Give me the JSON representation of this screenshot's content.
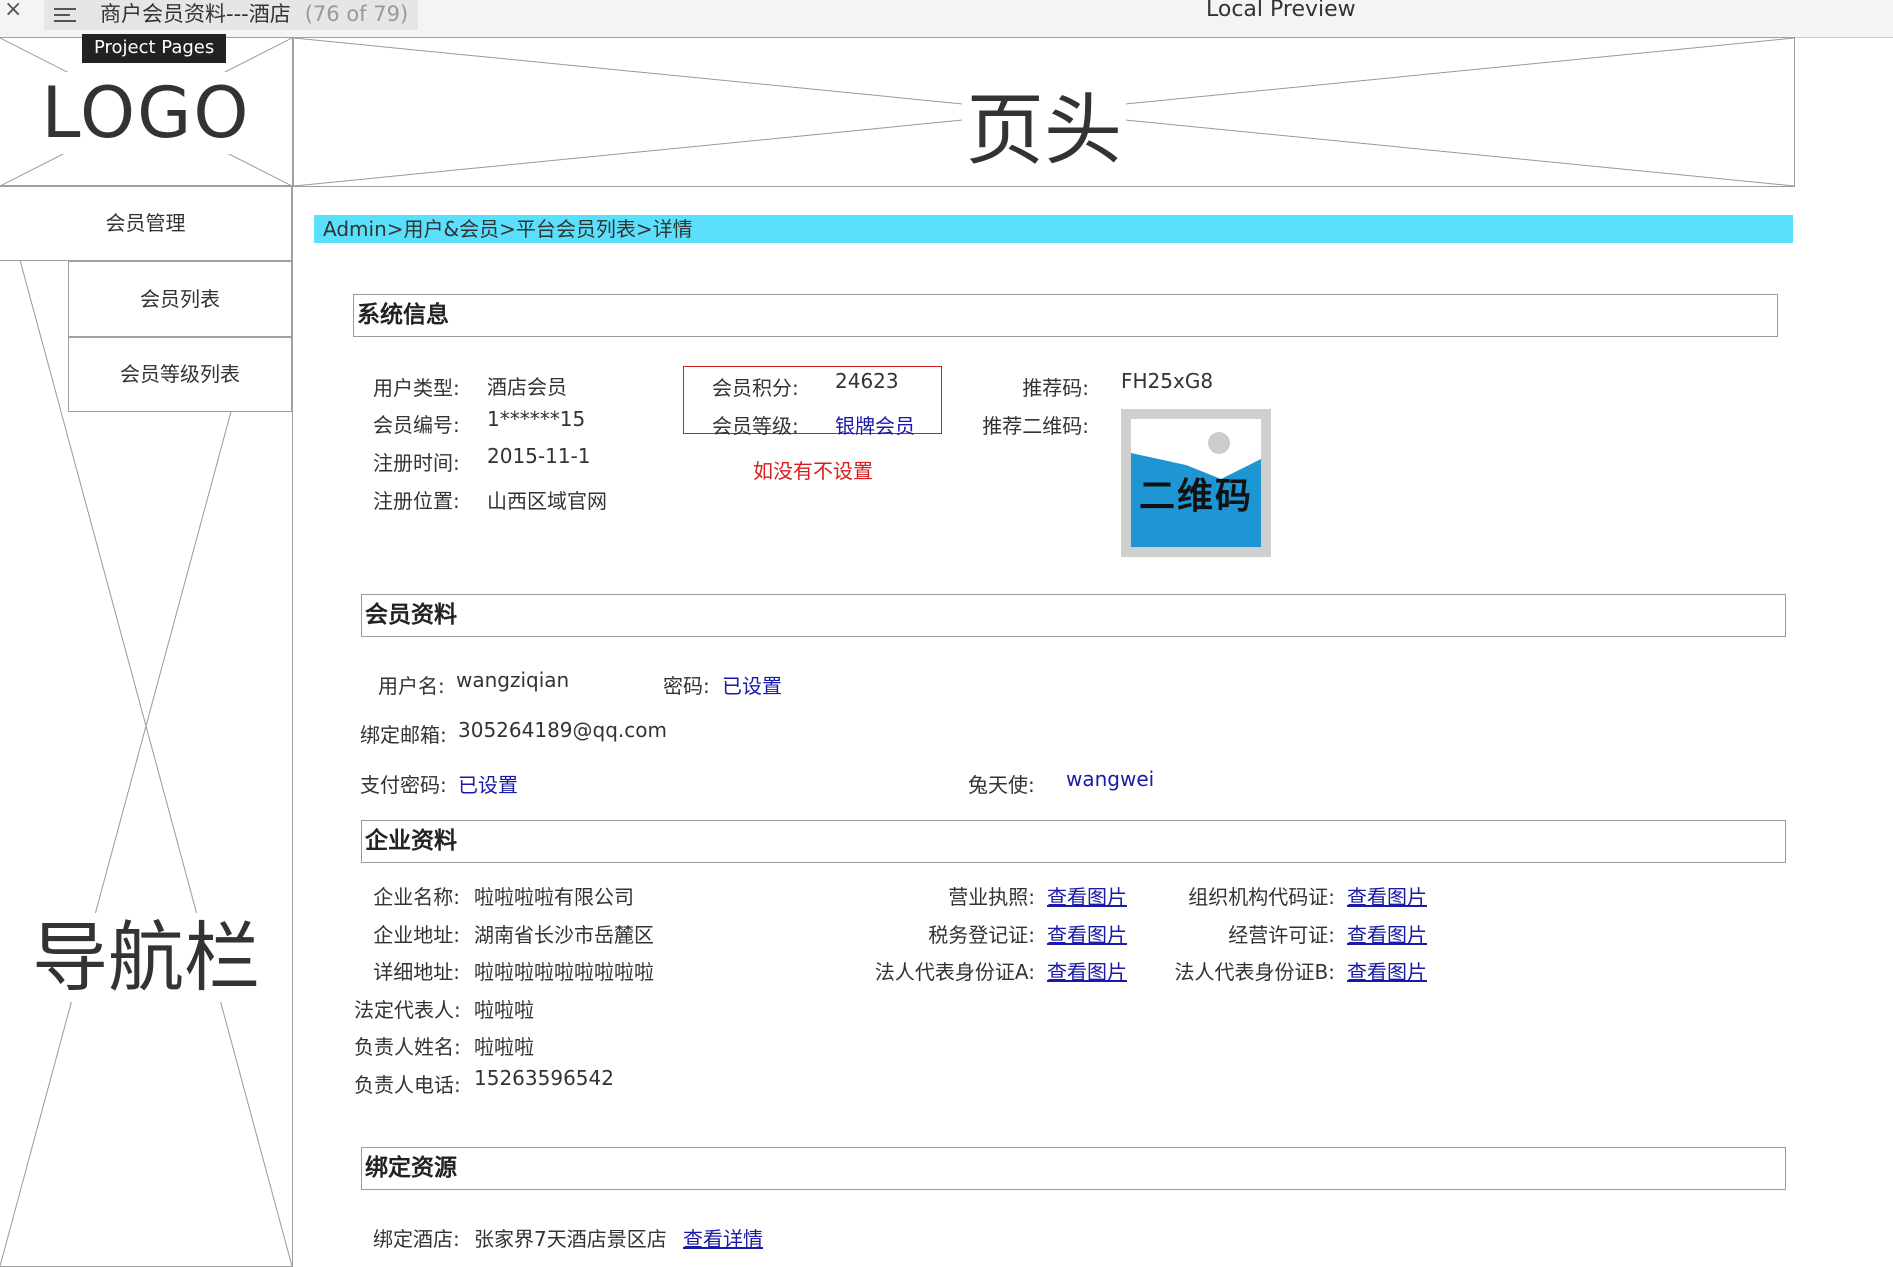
{
  "window": {
    "tab_title": "商户会员资料---酒店",
    "page_count": "(76 of 79)",
    "preview_title": "Local Preview",
    "tooltip": "Project Pages"
  },
  "wireframe": {
    "logo_label": "LOGO",
    "header_label": "页头",
    "nav_label": "导航栏"
  },
  "sidebar": {
    "items": [
      {
        "label": "会员管理"
      },
      {
        "label": "会员列表"
      },
      {
        "label": "会员等级列表"
      }
    ]
  },
  "breadcrumb": "Admin>用户&会员>平台会员列表>详情",
  "system_info": {
    "title": "系统信息",
    "user_type_label": "用户类型:",
    "user_type": "酒店会员",
    "member_no_label": "会员编号:",
    "member_no": "1******15",
    "reg_time_label": "注册时间:",
    "reg_time": "2015-11-1",
    "reg_location_label": "注册位置:",
    "reg_location": "山西区域官网",
    "points_label": "会员积分:",
    "points": "24623",
    "level_label": "会员等级:",
    "level": "银牌会员",
    "note": "如没有不设置",
    "referral_label": "推荐码:",
    "referral_code": "FH25xG8",
    "qr_label": "推荐二维码:",
    "qr_text": "二维码"
  },
  "member_info": {
    "title": "会员资料",
    "username_label": "用户名:",
    "username": "wangziqian",
    "password_label": "密码:",
    "password": "已设置",
    "email_label": "绑定邮箱:",
    "email": "305264189@qq.com",
    "pay_password_label": "支付密码:",
    "pay_password": "已设置",
    "angel_label": "兔天使:",
    "angel": "wangwei"
  },
  "company_info": {
    "title": "企业资料",
    "name_label": "企业名称:",
    "name": "啦啦啦啦有限公司",
    "address_label": "企业地址:",
    "address": "湖南省长沙市岳麓区",
    "detail_address_label": "详细地址:",
    "detail_address": "啦啦啦啦啦啦啦啦啦",
    "legal_rep_label": "法定代表人:",
    "legal_rep": "啦啦啦",
    "contact_name_label": "负责人姓名:",
    "contact_name": "啦啦啦",
    "contact_phone_label": "负责人电话:",
    "contact_phone": "15263596542",
    "license_label": "营业执照:",
    "tax_label": "税务登记证:",
    "id_a_label": "法人代表身份证A:",
    "org_code_label": "组织机构代码证:",
    "permit_label": "经营许可证:",
    "id_b_label": "法人代表身份证B:",
    "view_image": "查看图片"
  },
  "bound_resources": {
    "title": "绑定资源",
    "hotel_label": "绑定酒店:",
    "hotel": "张家界7天酒店景区店",
    "view_detail": "查看详情"
  }
}
